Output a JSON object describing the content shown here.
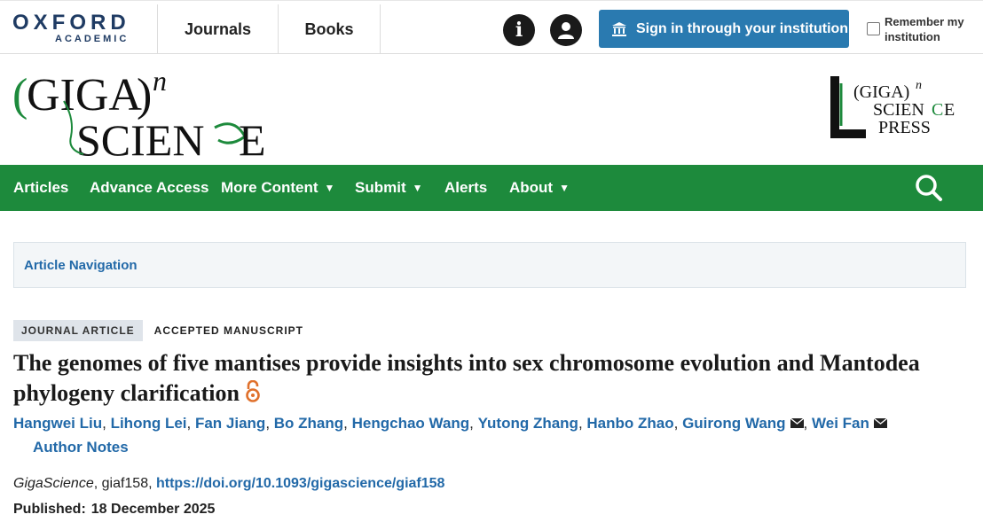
{
  "header": {
    "oxford_word": "OXFORD",
    "academic_word": "ACADEMIC",
    "nav": [
      {
        "label": "Journals"
      },
      {
        "label": "Books"
      }
    ],
    "info_icon": "info-icon",
    "user_icon": "account-icon",
    "signin_label": "Sign in through your institution",
    "remember_label": "Remember my institution"
  },
  "brand": {
    "journal_logo_text": "(GIGA)n SCIENCE",
    "press_logo_text": "(GIGA)n SCIENCE PRESS",
    "green": "#1d8a3c"
  },
  "main_nav": {
    "items": [
      {
        "label": "Articles",
        "dropdown": false
      },
      {
        "label": "Advance Access",
        "dropdown": false
      },
      {
        "label": "More Content",
        "dropdown": true
      },
      {
        "label": "Submit",
        "dropdown": true
      },
      {
        "label": "Alerts",
        "dropdown": false
      },
      {
        "label": "About",
        "dropdown": true
      }
    ],
    "caret": "▼",
    "search_icon": "search-icon"
  },
  "article_nav": {
    "label": "Article Navigation"
  },
  "article": {
    "type_tag": "JOURNAL ARTICLE",
    "status_tag": "ACCEPTED MANUSCRIPT",
    "title": "The genomes of five mantises provide insights into sex chromosome evolution and Mantodea phylogeny clarification",
    "open_access_icon": "open-access-icon",
    "authors": [
      {
        "name": "Hangwei Liu",
        "corresponding": false
      },
      {
        "name": "Lihong Lei",
        "corresponding": false
      },
      {
        "name": "Fan Jiang",
        "corresponding": false
      },
      {
        "name": "Bo Zhang",
        "corresponding": false
      },
      {
        "name": "Hengchao Wang",
        "corresponding": false
      },
      {
        "name": "Yutong Zhang",
        "corresponding": false
      },
      {
        "name": "Hanbo Zhao",
        "corresponding": false
      },
      {
        "name": "Guirong Wang",
        "corresponding": true
      },
      {
        "name": "Wei Fan",
        "corresponding": true
      }
    ],
    "author_notes_label": "Author Notes",
    "journal": "GigaScience",
    "article_id": "giaf158",
    "doi": "https://doi.org/10.1093/gigascience/giaf158",
    "published_label": "Published:",
    "published_date": "18 December 2025",
    "link_color": "#2269a8"
  }
}
